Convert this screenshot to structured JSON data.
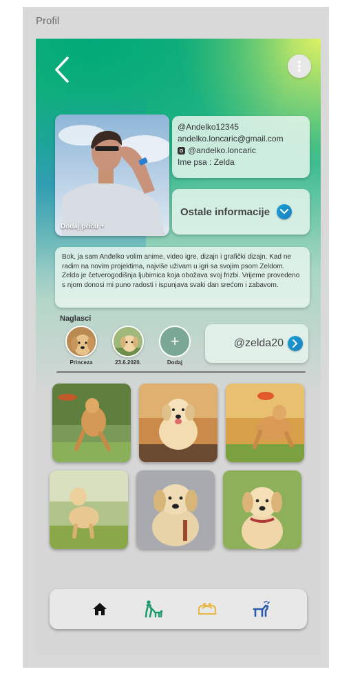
{
  "frame": {
    "title": "Profil"
  },
  "header": {
    "back_icon": "chevron-left-icon",
    "menu_icon": "more-vertical-icon"
  },
  "profile": {
    "add_story": "Dodaj priču +",
    "username": "@Andelko12345",
    "email": "andelko.loncaric@gmail.com",
    "instagram": "@andelko.loncaric",
    "dog_name": "Ime psa : Zelda",
    "more_info": "Ostale informacije",
    "bio": "Bok, ja sam  Anđelko volim anime, video igre, dizajn i grafički dizajn. Kad ne radim na novim projektima, najviše uživam u igri sa svojim psom Zeldom. Zelda je četverogodišnja ljubimica koja obožava svoj frizbi. Vrijeme provedeno s njom donosi mi puno radosti i ispunjava svaki dan srećom i zabavom."
  },
  "highlights": {
    "title": "Naglasci",
    "items": [
      {
        "label": "Princeza"
      },
      {
        "label": "23.6.2020."
      },
      {
        "label": "Dodaj"
      }
    ]
  },
  "dog_account": {
    "handle": "@zelda20"
  },
  "nav": {
    "items": [
      {
        "icon": "home-icon",
        "color": "#111111"
      },
      {
        "icon": "dog-walk-icon",
        "color": "#1a9a6a"
      },
      {
        "icon": "dog-bed-icon",
        "color": "#e6b94a"
      },
      {
        "icon": "dog-play-icon",
        "color": "#2a5aa8"
      }
    ]
  },
  "colors": {
    "accent": "#21b07e",
    "chevron": "#1b8ec9"
  }
}
